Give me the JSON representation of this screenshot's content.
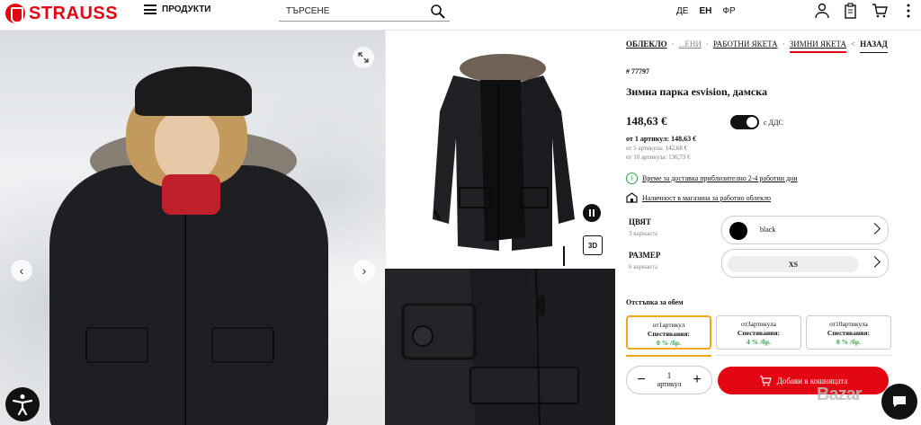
{
  "header": {
    "logo_text": "STRAUSS",
    "menu_label": "ПРОДУКТИ",
    "search_placeholder": "ТЪРСЕНЕ",
    "languages": [
      {
        "label": "ДЕ",
        "active": false
      },
      {
        "label": "ЕН",
        "active": true
      },
      {
        "label": "ФР",
        "active": false
      }
    ],
    "icons": [
      "user-icon",
      "clipboard-icon",
      "cart-icon",
      "more-icon"
    ]
  },
  "gallery": {
    "label_3d": "3D"
  },
  "breadcrumbs": [
    "ОБЛЕКЛО",
    "...ЕНИ",
    "РАБОТНИ ЯКЕТА",
    "ЗИМНИ ЯКЕТА"
  ],
  "back_label": "НАЗАД",
  "product": {
    "sku": "# 77797",
    "title": "Зимна парка esvision, дамска",
    "price": "148,63 €",
    "vat_label": "с ДДС",
    "tier_1": "от 1 артикул: 148,63 €",
    "tier_2": "от 5 артикула: 142,68 €",
    "tier_3": "от 10 артикула: 136,73 €"
  },
  "delivery_text": "Време за доставка приблизително 2-4 работни дни",
  "store_text": "Наличност в магазина за работно облекло",
  "color": {
    "label": "ЦВЯТ",
    "sub": "3 варианта",
    "value": "black",
    "swatch_hex": "#000000"
  },
  "size": {
    "label": "РАЗМЕР",
    "sub": "6 варианта",
    "value": "XS"
  },
  "discount": {
    "title": "Отстъпка за обем",
    "cards": [
      {
        "qty": "от1артикул",
        "save_label": "Спестявания:",
        "save": "0 % /бр."
      },
      {
        "qty": "от3артикула",
        "save_label": "Спестявания:",
        "save": "4 % /бр."
      },
      {
        "qty": "от10артикула",
        "save_label": "Спестявания:",
        "save": "8 % /бр."
      }
    ]
  },
  "quantity": {
    "value": "1",
    "unit": "артикул"
  },
  "add_to_cart": "Добави в кошницата",
  "watermark": "Bazar",
  "colors": {
    "brand": "#e30613",
    "accent": "#f1a61b",
    "success": "#2e9e48"
  }
}
